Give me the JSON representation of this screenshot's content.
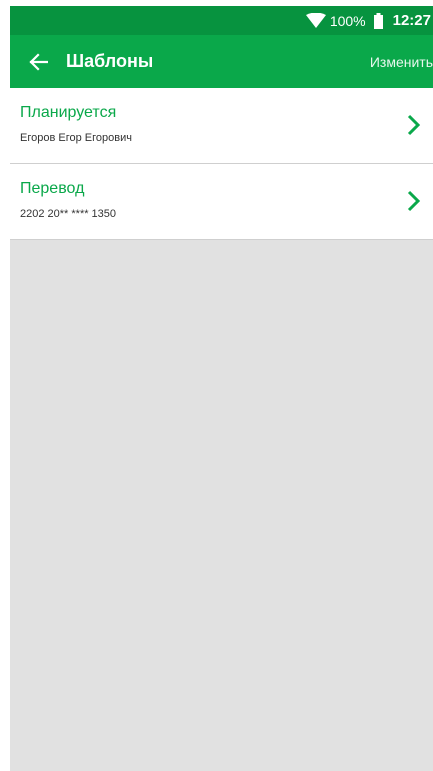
{
  "status_bar": {
    "battery": "100%",
    "time": "12:27",
    "icons": [
      "wifi-icon",
      "battery-icon"
    ]
  },
  "app_bar": {
    "title": "Шаблоны",
    "edit_label": "Изменить",
    "back_icon": "arrow-left-icon"
  },
  "templates": [
    {
      "title": "Планируется",
      "subtitle": "Егоров Егор Егорович"
    },
    {
      "title": "Перевод",
      "subtitle": "2202 20** **** 1350"
    }
  ],
  "colors": {
    "status_bar": "#07933f",
    "app_bar": "#0aa84a",
    "accent": "#0aa84a",
    "background": "#e1e1e1"
  }
}
